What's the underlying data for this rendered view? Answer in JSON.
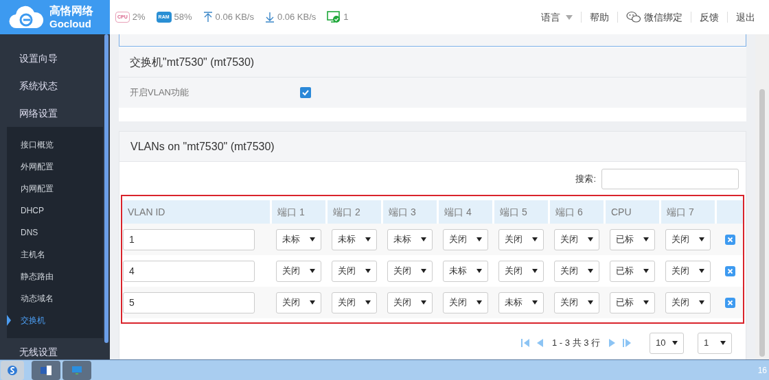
{
  "header": {
    "logo": {
      "name": "高恪网络",
      "sub": "Gocloud"
    },
    "stats": [
      {
        "kind": "cpu",
        "chip": "CPU",
        "value": "2%"
      },
      {
        "kind": "ram",
        "chip": "RAM",
        "value": "58%"
      },
      {
        "kind": "upload",
        "value": "0.06 KB/s"
      },
      {
        "kind": "download",
        "value": "0.06 KB/s"
      },
      {
        "kind": "devices",
        "value": "1"
      }
    ],
    "links": [
      {
        "kind": "dropdown",
        "label": "语言"
      },
      {
        "kind": "link",
        "label": "帮助"
      },
      {
        "kind": "wechat",
        "label": "微信绑定"
      },
      {
        "kind": "link",
        "label": "反馈"
      },
      {
        "kind": "link",
        "label": "退出"
      }
    ]
  },
  "sidebar": {
    "items": [
      {
        "label": "设置向导",
        "selected": false
      },
      {
        "label": "系统状态",
        "selected": false
      },
      {
        "label": "网络设置",
        "selected": false,
        "expanded": true,
        "children": [
          {
            "label": "接口概览",
            "selected": false
          },
          {
            "label": "外网配置",
            "selected": false
          },
          {
            "label": "内网配置",
            "selected": false
          },
          {
            "label": "DHCP",
            "selected": false
          },
          {
            "label": "DNS",
            "selected": false
          },
          {
            "label": "主机名",
            "selected": false
          },
          {
            "label": "静态路由",
            "selected": false
          },
          {
            "label": "动态域名",
            "selected": false
          },
          {
            "label": "交换机",
            "selected": true
          }
        ]
      },
      {
        "label": "无线设置",
        "selected": false
      }
    ]
  },
  "switch_card": {
    "title": "交换机\"mt7530\" (mt7530)",
    "vlan_label": "开启VLAN功能",
    "vlan_checked": true
  },
  "vlan_card": {
    "title": "VLANs on \"mt7530\" (mt7530)",
    "search_label": "搜索:",
    "table": {
      "columns": [
        "VLAN ID",
        "端口 1",
        "端口 2",
        "端口 3",
        "端口 4",
        "端口 5",
        "端口 6",
        "CPU",
        "端口 7"
      ],
      "rows": [
        {
          "vlan_id": "1",
          "ports": [
            "未标",
            "未标",
            "未标",
            "关闭",
            "关闭",
            "关闭",
            "已标",
            "关闭"
          ]
        },
        {
          "vlan_id": "4",
          "ports": [
            "关闭",
            "关闭",
            "关闭",
            "未标",
            "关闭",
            "关闭",
            "已标",
            "关闭"
          ]
        },
        {
          "vlan_id": "5",
          "ports": [
            "关闭",
            "关闭",
            "关闭",
            "关闭",
            "未标",
            "关闭",
            "已标",
            "关闭"
          ]
        }
      ]
    },
    "pagination": {
      "summary": "1 - 3 共 3 行",
      "page_size": "10",
      "page": "1"
    }
  },
  "taskbar": {
    "clock": "16"
  }
}
